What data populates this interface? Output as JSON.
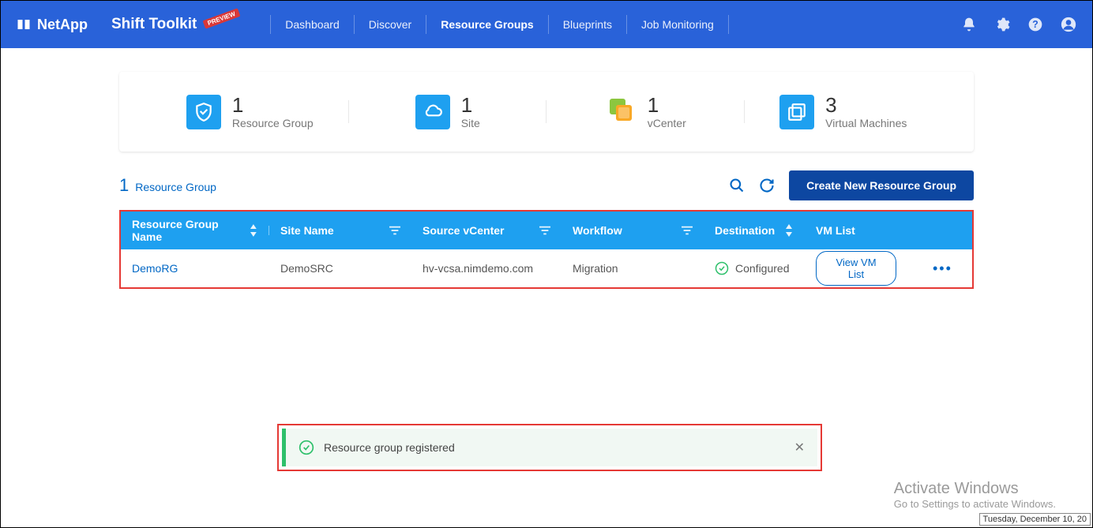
{
  "header": {
    "brand": "NetApp",
    "product": "Shift Toolkit",
    "badge": "PREVIEW",
    "nav": [
      "Dashboard",
      "Discover",
      "Resource Groups",
      "Blueprints",
      "Job Monitoring"
    ]
  },
  "stats": [
    {
      "value": "1",
      "label": "Resource Group"
    },
    {
      "value": "1",
      "label": "Site"
    },
    {
      "value": "1",
      "label": "vCenter"
    },
    {
      "value": "3",
      "label": "Virtual Machines"
    }
  ],
  "toolbar": {
    "count": "1",
    "count_label": "Resource Group",
    "create_label": "Create New Resource Group"
  },
  "table": {
    "headers": {
      "name": "Resource Group Name",
      "site": "Site Name",
      "source": "Source vCenter",
      "workflow": "Workflow",
      "destination": "Destination",
      "vmlist": "VM List"
    },
    "row": {
      "name": "DemoRG",
      "site": "DemoSRC",
      "source": "hv-vcsa.nimdemo.com",
      "workflow": "Migration",
      "destination": "Configured",
      "view": "View VM List"
    }
  },
  "toast": {
    "message": "Resource group registered"
  },
  "watermark": {
    "title": "Activate Windows",
    "sub": "Go to Settings to activate Windows."
  },
  "datechip": "Tuesday, December 10, 20"
}
